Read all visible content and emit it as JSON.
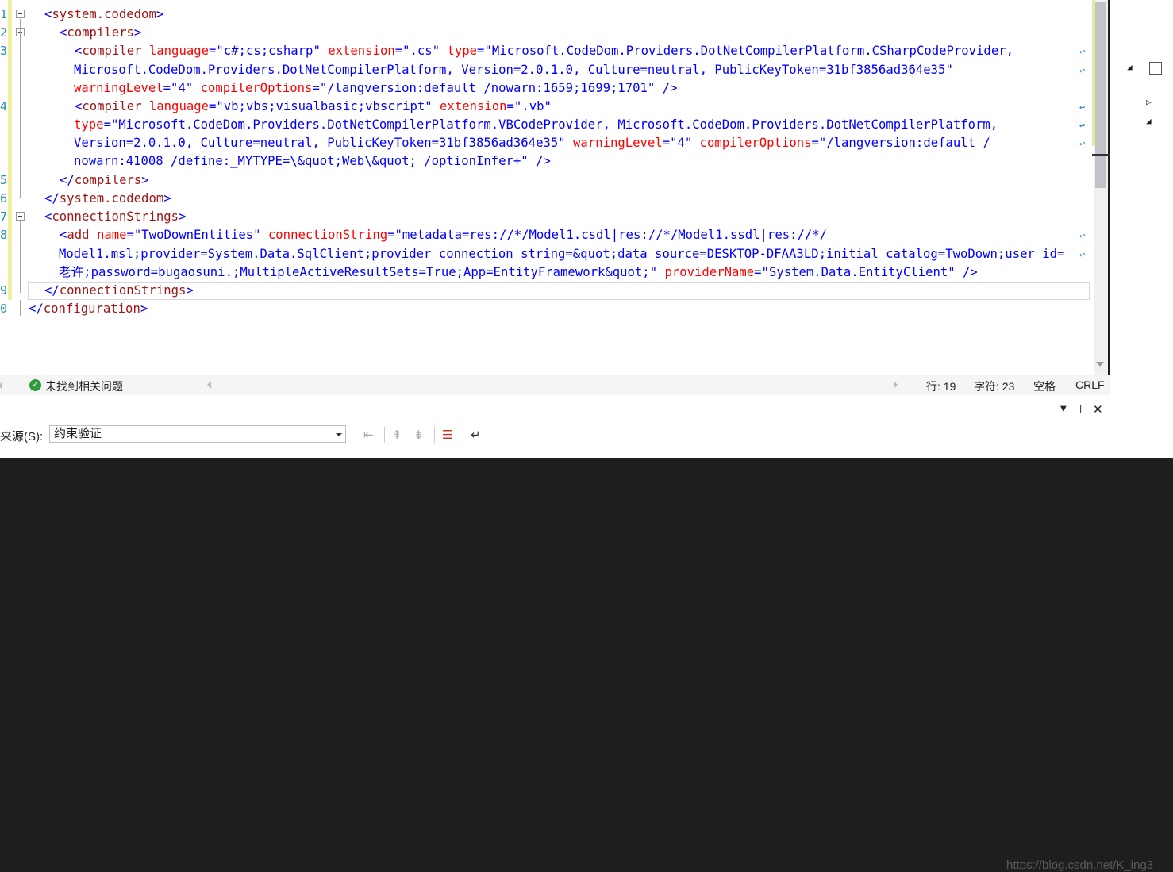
{
  "editor": {
    "line_numbers": [
      "1",
      "2",
      "3",
      "",
      "",
      "4",
      "",
      "",
      "",
      "5",
      "6",
      "7",
      "8",
      "",
      "",
      "9",
      "0"
    ],
    "lines": [
      {
        "segments": [
          {
            "c": "br",
            "t": "<"
          },
          {
            "c": "el",
            "t": "system.codedom"
          },
          {
            "c": "br",
            "t": ">"
          }
        ]
      },
      {
        "segments": [
          {
            "c": "br",
            "t": "<"
          },
          {
            "c": "el",
            "t": "compilers"
          },
          {
            "c": "br",
            "t": ">"
          }
        ]
      },
      {
        "segments": [
          {
            "c": "br",
            "t": "<"
          },
          {
            "c": "el",
            "t": "compiler"
          },
          {
            "c": "tx",
            "t": " "
          },
          {
            "c": "at",
            "t": "language"
          },
          {
            "c": "br",
            "t": "=\""
          },
          {
            "c": "va",
            "t": "c#;cs;csharp"
          },
          {
            "c": "br",
            "t": "\""
          },
          {
            "c": "tx",
            "t": " "
          },
          {
            "c": "at",
            "t": "extension"
          },
          {
            "c": "br",
            "t": "=\""
          },
          {
            "c": "va",
            "t": ".cs"
          },
          {
            "c": "br",
            "t": "\""
          },
          {
            "c": "tx",
            "t": " "
          },
          {
            "c": "at",
            "t": "type"
          },
          {
            "c": "br",
            "t": "=\""
          },
          {
            "c": "va",
            "t": "Microsoft.CodeDom.Providers.DotNetCompilerPlatform.CSharpCodeProvider,"
          }
        ]
      },
      {
        "segments": [
          {
            "c": "va",
            "t": "Microsoft.CodeDom.Providers.DotNetCompilerPlatform, Version=2.0.1.0, Culture=neutral, PublicKeyToken=31bf3856ad364e35"
          },
          {
            "c": "br",
            "t": "\""
          }
        ]
      },
      {
        "segments": [
          {
            "c": "at",
            "t": "warningLevel"
          },
          {
            "c": "br",
            "t": "=\""
          },
          {
            "c": "va",
            "t": "4"
          },
          {
            "c": "br",
            "t": "\""
          },
          {
            "c": "tx",
            "t": " "
          },
          {
            "c": "at",
            "t": "compilerOptions"
          },
          {
            "c": "br",
            "t": "=\""
          },
          {
            "c": "va",
            "t": "/langversion:default /nowarn:1659;1699;1701"
          },
          {
            "c": "br",
            "t": "\" />"
          }
        ]
      },
      {
        "segments": [
          {
            "c": "br",
            "t": "<"
          },
          {
            "c": "el",
            "t": "compiler"
          },
          {
            "c": "tx",
            "t": " "
          },
          {
            "c": "at",
            "t": "language"
          },
          {
            "c": "br",
            "t": "=\""
          },
          {
            "c": "va",
            "t": "vb;vbs;visualbasic;vbscript"
          },
          {
            "c": "br",
            "t": "\""
          },
          {
            "c": "tx",
            "t": " "
          },
          {
            "c": "at",
            "t": "extension"
          },
          {
            "c": "br",
            "t": "=\""
          },
          {
            "c": "va",
            "t": ".vb"
          },
          {
            "c": "br",
            "t": "\""
          }
        ]
      },
      {
        "segments": [
          {
            "c": "at",
            "t": "type"
          },
          {
            "c": "br",
            "t": "=\""
          },
          {
            "c": "va",
            "t": "Microsoft.CodeDom.Providers.DotNetCompilerPlatform.VBCodeProvider, Microsoft.CodeDom.Providers.DotNetCompilerPlatform,"
          }
        ]
      },
      {
        "segments": [
          {
            "c": "va",
            "t": "Version=2.0.1.0, Culture=neutral, PublicKeyToken=31bf3856ad364e35"
          },
          {
            "c": "br",
            "t": "\""
          },
          {
            "c": "tx",
            "t": " "
          },
          {
            "c": "at",
            "t": "warningLevel"
          },
          {
            "c": "br",
            "t": "=\""
          },
          {
            "c": "va",
            "t": "4"
          },
          {
            "c": "br",
            "t": "\""
          },
          {
            "c": "tx",
            "t": " "
          },
          {
            "c": "at",
            "t": "compilerOptions"
          },
          {
            "c": "br",
            "t": "=\""
          },
          {
            "c": "va",
            "t": "/langversion:default /"
          }
        ]
      },
      {
        "segments": [
          {
            "c": "va",
            "t": "nowarn:41008 /define:_MYTYPE=\\&quot;Web\\&quot; /optionInfer+"
          },
          {
            "c": "br",
            "t": "\" />"
          }
        ]
      },
      {
        "segments": [
          {
            "c": "br",
            "t": "</"
          },
          {
            "c": "el",
            "t": "compilers"
          },
          {
            "c": "br",
            "t": ">"
          }
        ]
      },
      {
        "segments": [
          {
            "c": "br",
            "t": "</"
          },
          {
            "c": "el",
            "t": "system.codedom"
          },
          {
            "c": "br",
            "t": ">"
          }
        ]
      },
      {
        "segments": [
          {
            "c": "br",
            "t": "<"
          },
          {
            "c": "el",
            "t": "connectionStrings"
          },
          {
            "c": "br",
            "t": ">"
          }
        ]
      },
      {
        "segments": [
          {
            "c": "br",
            "t": "<"
          },
          {
            "c": "el",
            "t": "add"
          },
          {
            "c": "tx",
            "t": " "
          },
          {
            "c": "at",
            "t": "name"
          },
          {
            "c": "br",
            "t": "=\""
          },
          {
            "c": "va",
            "t": "TwoDownEntities"
          },
          {
            "c": "br",
            "t": "\""
          },
          {
            "c": "tx",
            "t": " "
          },
          {
            "c": "at",
            "t": "connectionString"
          },
          {
            "c": "br",
            "t": "=\""
          },
          {
            "c": "va",
            "t": "metadata=res://*/Model1.csdl|res://*/Model1.ssdl|res://*/"
          }
        ]
      },
      {
        "segments": [
          {
            "c": "va",
            "t": "Model1.msl;provider=System.Data.SqlClient;provider connection string=&quot;data source=DESKTOP-DFAA3LD;initial catalog=TwoDown;user id="
          }
        ]
      },
      {
        "segments": [
          {
            "c": "va",
            "t": "老许;password=bugaosuni.;MultipleActiveResultSets=True;App=EntityFramework&quot;"
          },
          {
            "c": "br",
            "t": "\""
          },
          {
            "c": "tx",
            "t": " "
          },
          {
            "c": "at",
            "t": "providerName"
          },
          {
            "c": "br",
            "t": "=\""
          },
          {
            "c": "va",
            "t": "System.Data.EntityClient"
          },
          {
            "c": "br",
            "t": "\" />"
          }
        ]
      },
      {
        "segments": [
          {
            "c": "br",
            "t": "</"
          },
          {
            "c": "el",
            "t": "connectionStrings"
          },
          {
            "c": "br",
            "t": ">"
          }
        ]
      },
      {
        "segments": [
          {
            "c": "br",
            "t": "</"
          },
          {
            "c": "el",
            "t": "configuration"
          },
          {
            "c": "br",
            "t": ">"
          }
        ]
      }
    ]
  },
  "status": {
    "issues": "未找到相关问题",
    "line": "行: 19",
    "char": "字符: 23",
    "whitespace": "空格",
    "eol": "CRLF"
  },
  "output_panel": {
    "source_label": "来源(S):",
    "source_value": "约束验证"
  },
  "watermark": "https://blog.csdn.net/K_ing3",
  "colors": {
    "bracket": "#0000ff",
    "element": "#a31515",
    "attribute": "#ff0000",
    "value": "#0000ff"
  }
}
